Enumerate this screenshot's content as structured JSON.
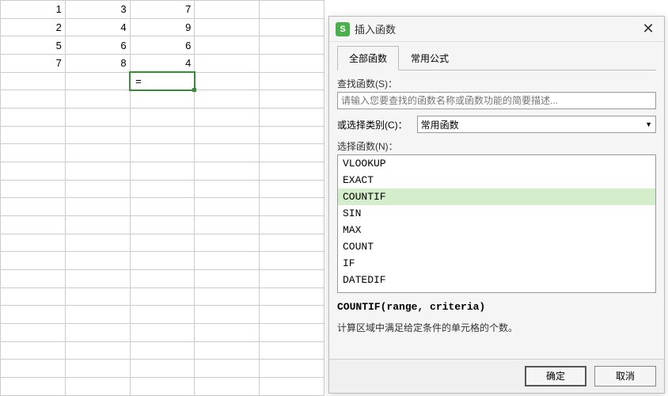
{
  "spreadsheet": {
    "rows": [
      {
        "c1": "1",
        "c2": "3",
        "c3": "7"
      },
      {
        "c1": "2",
        "c2": "4",
        "c3": "9"
      },
      {
        "c1": "5",
        "c2": "6",
        "c3": "6"
      },
      {
        "c1": "7",
        "c2": "8",
        "c3": "4"
      }
    ],
    "active_cell_value": "="
  },
  "dialog": {
    "title": "插入函数",
    "app_icon_letter": "S",
    "tabs": {
      "all": "全部函数",
      "common": "常用公式"
    },
    "search": {
      "label": "查找函数(S)：",
      "placeholder": "请输入您要查找的函数名称或函数功能的简要描述..."
    },
    "category": {
      "label": "或选择类别(C)：",
      "selected": "常用函数"
    },
    "select_label": "选择函数(N)：",
    "functions": [
      "VLOOKUP",
      "EXACT",
      "COUNTIF",
      "SIN",
      "MAX",
      "COUNT",
      "IF",
      "DATEDIF"
    ],
    "selected_index": 2,
    "description": {
      "signature": "COUNTIF(range, criteria)",
      "text": "计算区域中满足给定条件的单元格的个数。"
    },
    "buttons": {
      "ok": "确定",
      "cancel": "取消"
    }
  }
}
